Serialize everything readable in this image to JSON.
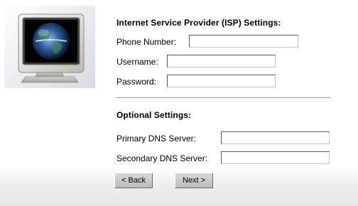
{
  "isp_section": {
    "heading": "Internet Service Provider (ISP) Settings:",
    "phone_label": "Phone Number:",
    "phone_value": "",
    "username_label": "Username:",
    "username_value": "",
    "password_label": "Password:",
    "password_value": ""
  },
  "optional_section": {
    "heading": "Optional Settings:",
    "primary_dns_label": "Primary DNS Server:",
    "primary_dns_value": "",
    "secondary_dns_label": "Secondary DNS Server:",
    "secondary_dns_value": ""
  },
  "buttons": {
    "back_label": "< Back",
    "next_label": "Next >"
  },
  "icons": {
    "monitor": "computer-monitor-globe-icon"
  }
}
